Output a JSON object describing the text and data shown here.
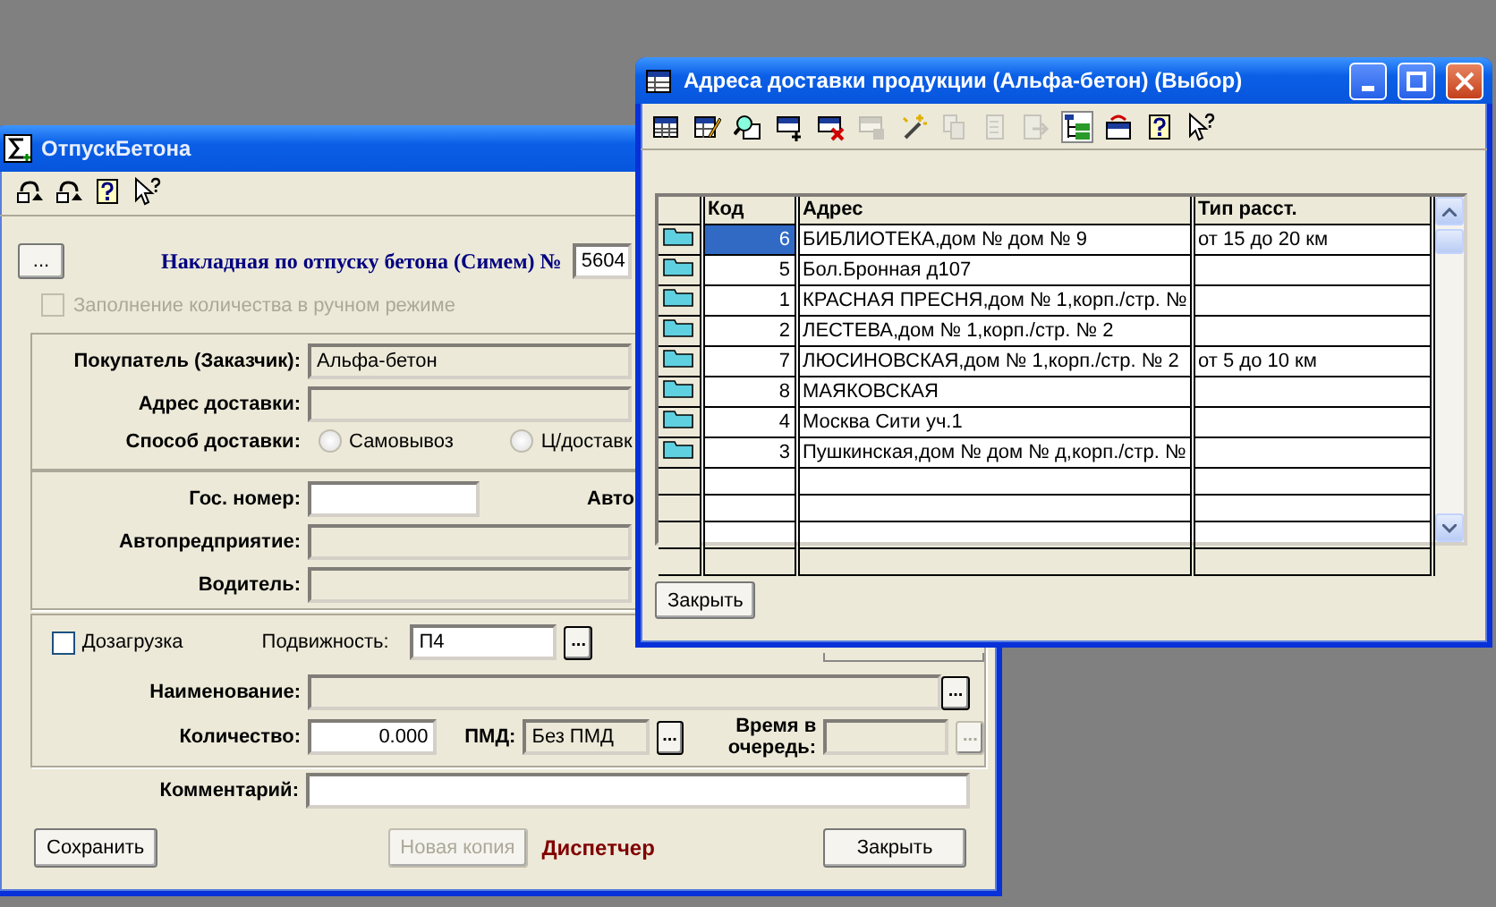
{
  "back_window": {
    "title": "ОтпускБетона",
    "toolbar": [
      {
        "kind": "undo",
        "disabled": false
      },
      {
        "kind": "redo",
        "disabled": false
      },
      {
        "kind": "help",
        "disabled": false
      },
      {
        "kind": "whats_this",
        "disabled": false
      }
    ],
    "header": {
      "more_button": "...",
      "label": "Накладная по отпуску бетона (Симем) №",
      "number": "5604"
    },
    "manual_fill": {
      "label": "Заполнение количества в ручном режиме",
      "checked": false,
      "disabled": true
    },
    "buyer": {
      "label": "Покупатель (Заказчик):",
      "value": "Альфа-бетон",
      "editable": false
    },
    "delivery_address": {
      "label": "Адрес доставки:",
      "editable": false
    },
    "delivery_method": {
      "label": "Способ доставки:",
      "options": [
        {
          "label": "Самовывоз",
          "selected": false
        },
        {
          "label": "Ц/доставк",
          "selected": false
        }
      ]
    },
    "plate": {
      "label": "Гос. номер:",
      "editable": true
    },
    "auto_label": "Авто",
    "company": {
      "label": "Автопредприятие:",
      "editable": false
    },
    "driver": {
      "label": "Водитель:",
      "editable": false
    },
    "reload": {
      "label": "Дозагрузка",
      "checked": false
    },
    "mobility": {
      "label": "Подвижность:",
      "value": "П4",
      "button": "...",
      "editable": true
    },
    "product": {
      "label": "Наименование:",
      "button": "...",
      "editable": false
    },
    "quantity": {
      "label": "Количество:",
      "value": "0.000",
      "editable": true
    },
    "pmd": {
      "label": "ПМД:",
      "value": "Без ПМД",
      "button": "...",
      "editable": false
    },
    "queue_time": {
      "label": "Время в очередь:",
      "button": "...",
      "disabled": true
    },
    "comment": {
      "label": "Комментарий:",
      "editable": true
    },
    "buttons": [
      {
        "label": "Сохранить",
        "disabled": false
      },
      {
        "label": "Новая копия",
        "disabled": true
      }
    ],
    "role": "Диспетчер",
    "close_button": "Закрыть"
  },
  "picker_window": {
    "title": "Адреса доставки продукции (Альфа-бетон) (Выбор)",
    "toolbar": [
      {
        "kind": "table",
        "disabled": false,
        "pressed": false
      },
      {
        "kind": "table_edit",
        "disabled": false,
        "pressed": false
      },
      {
        "kind": "find",
        "disabled": false,
        "pressed": false
      },
      {
        "kind": "row_add",
        "disabled": false,
        "pressed": false
      },
      {
        "kind": "row_delete",
        "disabled": false,
        "pressed": false
      },
      {
        "kind": "row_save",
        "disabled": true,
        "pressed": false
      },
      {
        "kind": "wand",
        "disabled": false,
        "pressed": false
      },
      {
        "kind": "copy",
        "disabled": true,
        "pressed": false
      },
      {
        "kind": "page",
        "disabled": true,
        "pressed": false
      },
      {
        "kind": "page_arrow",
        "disabled": true,
        "pressed": false
      },
      {
        "kind": "tree",
        "disabled": false,
        "pressed": true
      },
      {
        "kind": "table_arrow",
        "disabled": false,
        "pressed": false
      },
      {
        "kind": "help",
        "disabled": false,
        "pressed": false
      },
      {
        "kind": "whats_this",
        "disabled": false,
        "pressed": false
      }
    ],
    "columns": [
      "Код",
      "Адрес",
      "Тип расст."
    ],
    "rows": [
      {
        "code": "6",
        "address": "БИБЛИОТЕКА,дом № дом № 9",
        "distance": "от 15 до 20 км",
        "selected": true
      },
      {
        "code": "5",
        "address": "Бол.Бронная д107",
        "selected": false
      },
      {
        "code": "1",
        "address": "КРАСНАЯ ПРЕСНЯ,дом № 1,корп./стр. №",
        "selected": false
      },
      {
        "code": "2",
        "address": "ЛЕСТЕВА,дом № 1,корп./стр. № 2",
        "selected": false
      },
      {
        "code": "7",
        "address": "ЛЮСИНОВСКАЯ,дом № 1,корп./стр. № 2",
        "distance": "от 5 до 10 км",
        "selected": false
      },
      {
        "code": "8",
        "address": "МАЯКОВСКАЯ",
        "selected": false
      },
      {
        "code": "4",
        "address": "Москва Сити уч.1",
        "selected": false
      },
      {
        "code": "3",
        "address": "Пушкинская,дом № дом № д,корп./стр. №",
        "selected": false
      }
    ],
    "close_button": "Закрыть"
  }
}
